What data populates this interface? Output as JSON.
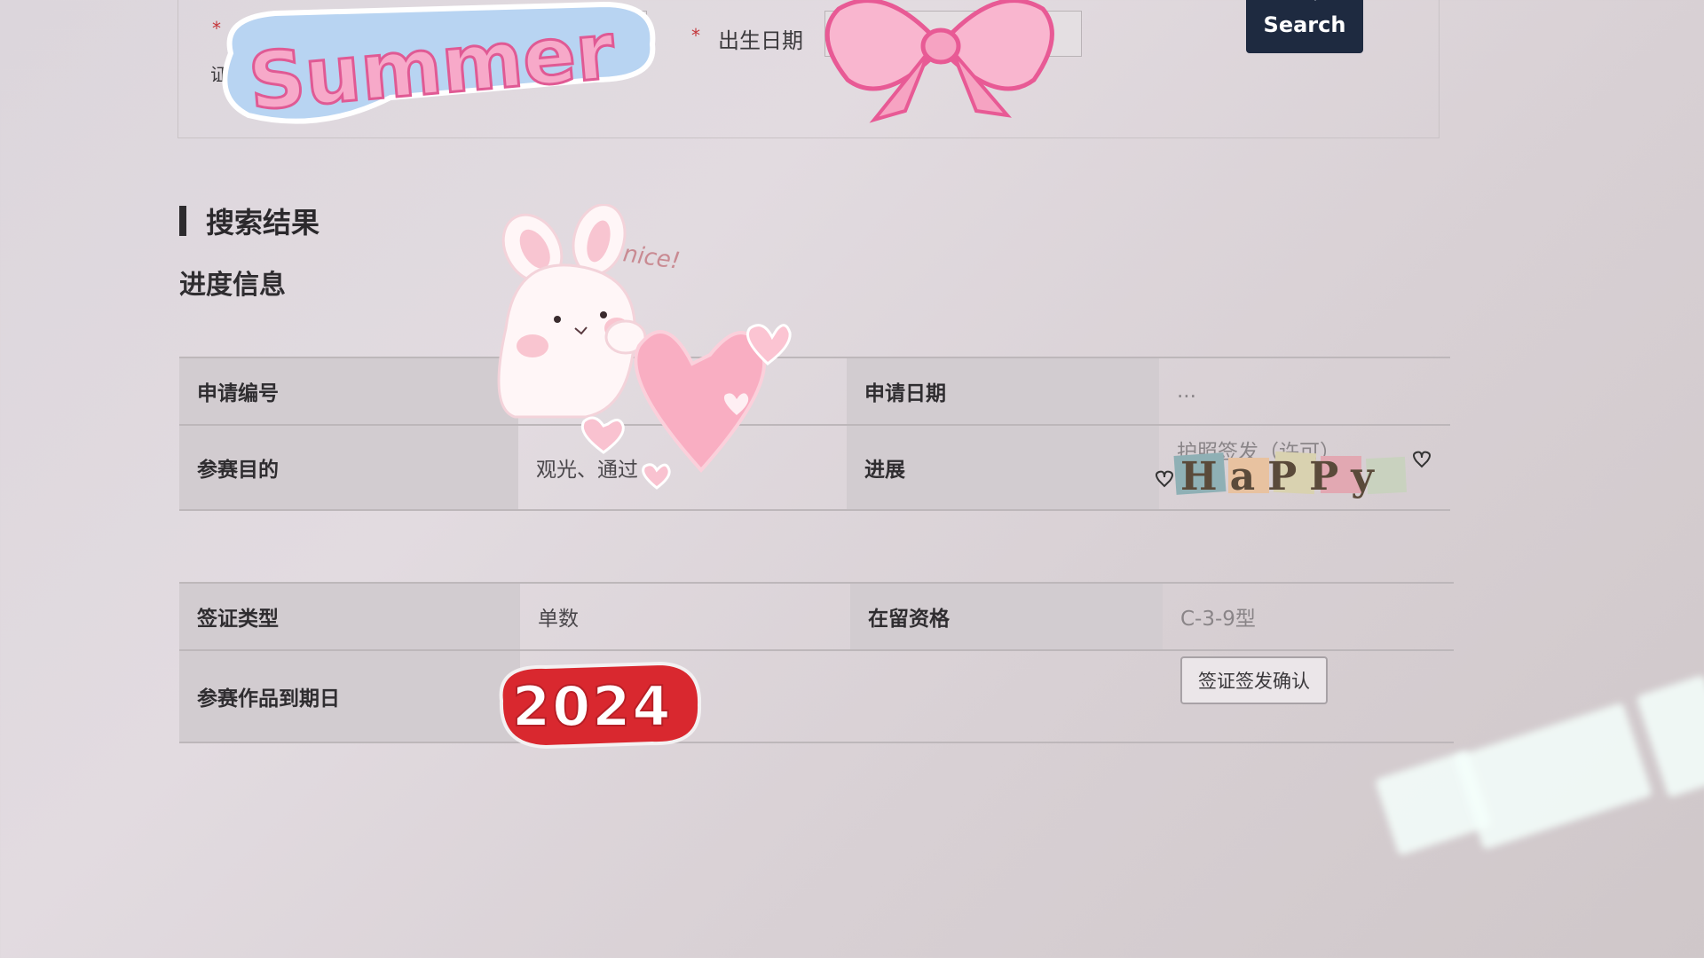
{
  "search": {
    "birth_date_label": "出生日期",
    "second_field_label_fragment": "证",
    "search_button_label": "Search"
  },
  "results": {
    "section_title": "搜索结果",
    "subsection_title": "进度信息",
    "table1": {
      "rows": [
        {
          "label_left": "申请编号",
          "value_left": "",
          "label_right": "申请日期",
          "value_right": "..."
        },
        {
          "label_left": "参赛目的",
          "value_left": "观光、通过",
          "label_right": "进展",
          "value_right": "护照签发（许可）"
        }
      ]
    },
    "table2": {
      "rows": [
        {
          "label_left": "签证类型",
          "value_left": "单数",
          "label_right": "在留资格",
          "value_right": "C-3-9型"
        },
        {
          "label_left": "参赛作品到期日",
          "value_left": "",
          "label_right": "",
          "button_label": "签证签发确认"
        }
      ]
    }
  },
  "stickers": {
    "summer_text": "Summer",
    "nice_text": "nice!",
    "happy_text": "HaPPy",
    "year_text": "2024"
  },
  "colors": {
    "search_button_bg": "#1e2a40",
    "required_star": "#c4353a",
    "label_cell_bg": "#d2ccd0",
    "sticker_pink": "#f07aa8",
    "year_red": "#d9282f"
  }
}
